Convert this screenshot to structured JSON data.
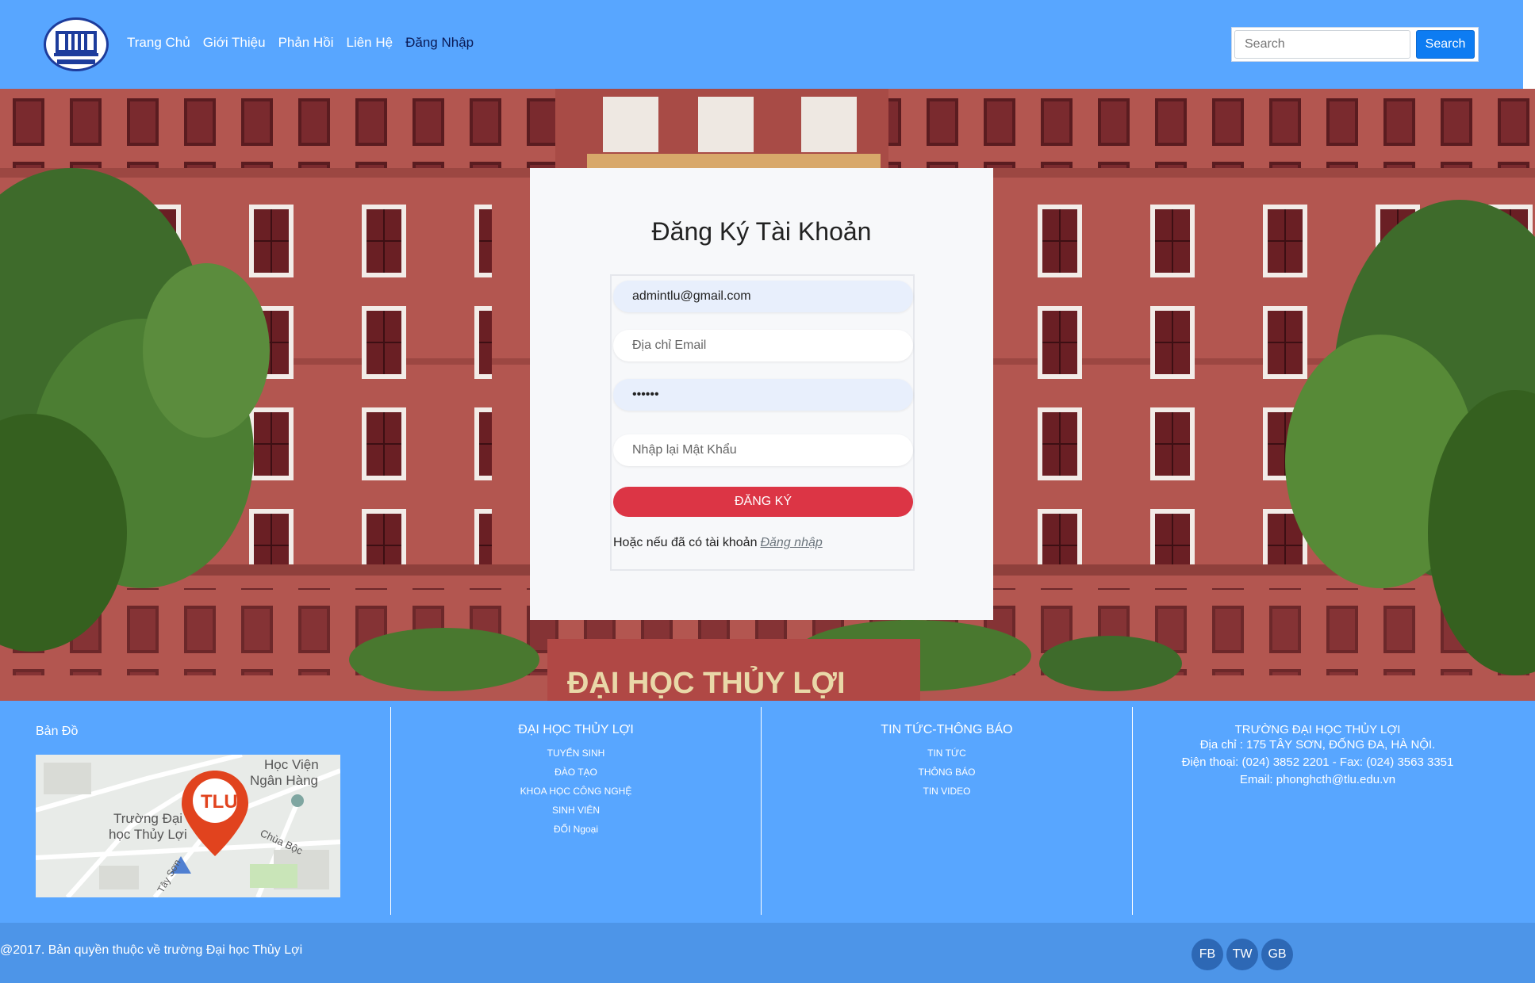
{
  "nav": {
    "links": [
      "Trang Chủ",
      "Giới Thiệu",
      "Phản Hồi",
      "Liên Hệ",
      "Đăng Nhập"
    ],
    "active_index": 4
  },
  "search": {
    "placeholder": "Search",
    "button_label": "Search"
  },
  "hero": {
    "sign_text": "ĐẠI HỌC THỦY LỢI"
  },
  "register": {
    "title": "Đăng Ký Tài Khoản",
    "username_value": "admintlu@gmail.com",
    "email_placeholder": "Địa chỉ Email",
    "password_value": "••••••",
    "confirm_placeholder": "Nhập lại Mật Khẩu",
    "submit_label": "ĐĂNG KÝ",
    "login_prompt": "Hoặc nếu đã có tài khoản",
    "login_link": "Đăng nhập"
  },
  "footer": {
    "map_title": "Bản Đồ",
    "map_labels": {
      "institute_1": "Học Viện",
      "institute_2": "Ngân Hàng",
      "school_1": "Trường Đại",
      "school_2": "học Thủy Lợi",
      "marker": "TLU",
      "street_1": "Chùa Bộc",
      "street_2": "Tây Sơn"
    },
    "col2": {
      "title": "ĐẠI HỌC THỦY LỢI",
      "items": [
        "TUYỂN SINH",
        "ĐÀO TẠO",
        "KHOA HỌC CÔNG NGHỆ",
        "SINH VIÊN",
        "ĐỐI Ngoại"
      ]
    },
    "col3": {
      "title": "TIN TỨC-THÔNG BÁO",
      "items": [
        "TIN TỨC",
        "THÔNG BÁO",
        "TIN VIDEO"
      ]
    },
    "col4": {
      "title": "TRƯỜNG ĐẠI HỌC THỦY LỢI",
      "address": "Địa chỉ : 175 TÂY SƠN, ĐỐNG ĐA, HÀ NỘI.",
      "phone": "Điện thoại: (024) 3852 2201 - Fax: (024) 3563 3351",
      "email": "Email: phonghcth@tlu.edu.vn"
    }
  },
  "copyright": {
    "text": "@2017. Bản quyền thuộc về trường Đại học Thủy Lợi",
    "social": [
      "FB",
      "TW",
      "GB"
    ]
  },
  "colors": {
    "brand_blue": "#58a6ff",
    "danger": "#dc3545",
    "primary": "#0d7cf2"
  }
}
